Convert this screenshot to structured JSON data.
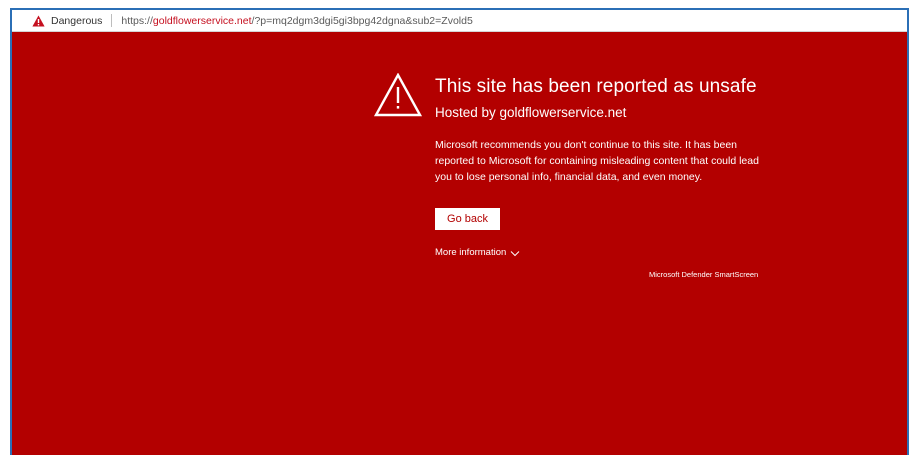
{
  "address_bar": {
    "status_label": "Dangerous",
    "url_scheme": "https://",
    "url_host": "goldflowerservice.net",
    "url_path": "/?p=mq2dgm3dgi5gi3bpg42dgna&sub2=Zvold5"
  },
  "warning": {
    "title": "This site has been reported as unsafe",
    "hosted_by": "Hosted by goldflowerservice.net",
    "description": "Microsoft recommends you don't continue to this site. It has been reported to Microsoft for containing misleading content that could lead you to lose personal info, financial data, and even money.",
    "go_back_label": "Go back",
    "more_info_label": "More information",
    "brand_label": "Microsoft Defender SmartScreen"
  },
  "colors": {
    "page_background": "#b30000",
    "danger_red": "#c50f1f",
    "text_on_red": "#ffffff"
  },
  "icons": {
    "status": "warning-triangle-icon",
    "hero": "warning-triangle-icon",
    "expand": "chevron-down-icon"
  }
}
